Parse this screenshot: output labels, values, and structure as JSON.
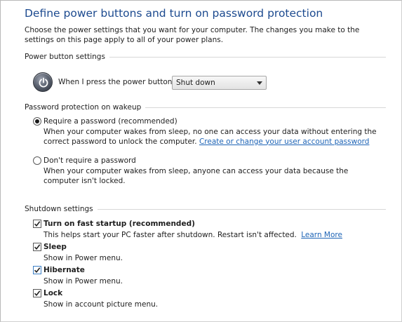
{
  "title": "Define power buttons and turn on password protection",
  "intro": "Choose the power settings that you want for your computer. The changes you make to the settings on this page apply to all of your power plans.",
  "power_section": {
    "heading": "Power button settings",
    "icon": "power-icon",
    "label": "When I press the power button:",
    "selected": "Shut down"
  },
  "password_section": {
    "heading": "Password protection on wakeup",
    "options": [
      {
        "label": "Require a password (recommended)",
        "checked": true,
        "desc": "When your computer wakes from sleep, no one can access your data without entering the correct password to unlock the computer.",
        "link": "Create or change your user account password"
      },
      {
        "label": "Don't require a password",
        "checked": false,
        "desc": "When your computer wakes from sleep, anyone can access your data because the computer isn't locked."
      }
    ]
  },
  "shutdown_section": {
    "heading": "Shutdown settings",
    "items": [
      {
        "label": "Turn on fast startup (recommended)",
        "checked": true,
        "desc": "This helps start your PC faster after shutdown. Restart isn't affected.",
        "link": "Learn More"
      },
      {
        "label": "Sleep",
        "checked": true,
        "desc": "Show in Power menu."
      },
      {
        "label": "Hibernate",
        "checked": true,
        "desc": "Show in Power menu."
      },
      {
        "label": "Lock",
        "checked": true,
        "desc": "Show in account picture menu."
      }
    ]
  },
  "colors": {
    "title": "#1c4a8f",
    "link": "#1e64b6"
  }
}
